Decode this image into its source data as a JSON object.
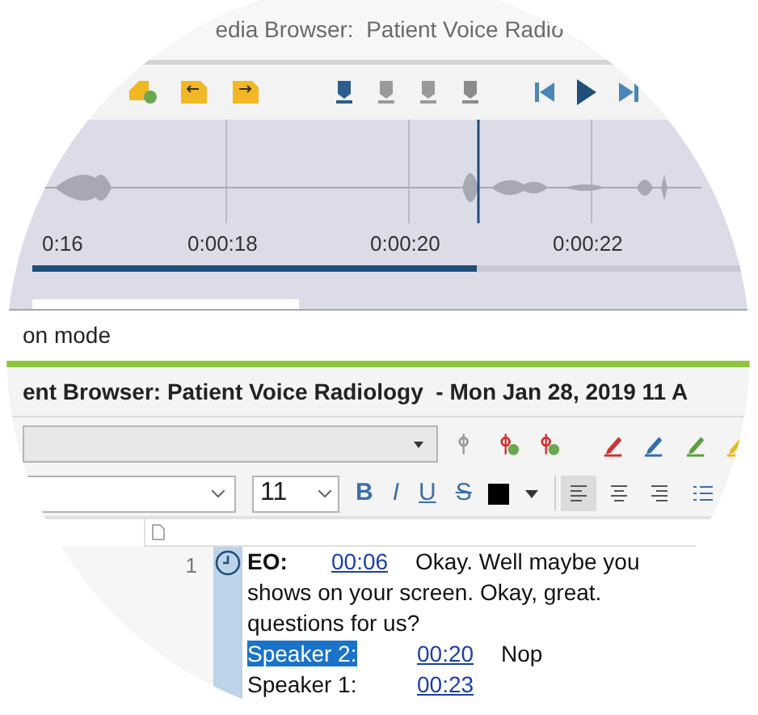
{
  "window": {
    "title": "edia Browser:  Patient Voice Radio"
  },
  "waveform": {
    "time_labels": [
      "0:16",
      "0:00:18",
      "0:00:20",
      "0:00:22"
    ],
    "playback": {
      "level": 0.62
    }
  },
  "mode_label": "on mode",
  "document": {
    "title": "ent Browser: Patient Voice Radiology  - Mon Jan 28, 2019 11 A"
  },
  "format_toolbar": {
    "font_size": "11",
    "style_buttons": [
      "B",
      "I",
      "U",
      "S"
    ],
    "alignments": [
      {
        "selected": true
      },
      {
        "selected": false
      },
      {
        "selected": false
      }
    ]
  },
  "transcript": [
    {
      "number": "1",
      "speaker": "EO:",
      "bold": true,
      "speaker_selected": false,
      "time": "00:06",
      "lines": [
        "Okay. Well maybe you",
        "shows on your screen. Okay, great.",
        "questions for us?"
      ]
    },
    {
      "speaker": "Speaker 2:",
      "bold": false,
      "speaker_selected": true,
      "time": "00:20",
      "lines": [
        "Nop"
      ]
    },
    {
      "speaker": "Speaker 1:",
      "bold": false,
      "speaker_selected": false,
      "time": "00:23"
    }
  ]
}
